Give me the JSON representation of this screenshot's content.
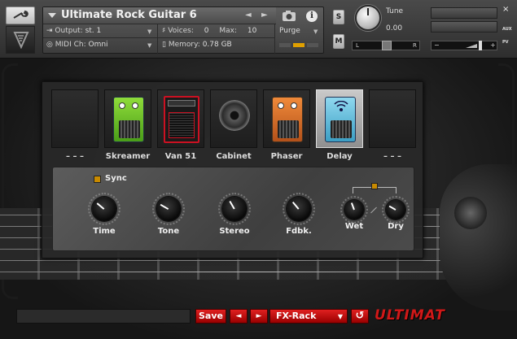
{
  "header": {
    "instrument_title": "Ultimate Rock Guitar 6",
    "output_label": "Output:",
    "output_value": "st. 1",
    "voices_label": "Voices:",
    "voices_value": "0",
    "max_label": "Max:",
    "max_value": "10",
    "purge_label": "Purge",
    "midi_label": "MIDI Ch:",
    "midi_value": "Omni",
    "memory_label": "Memory:",
    "memory_value": "0.78 GB",
    "solo_label": "S",
    "mute_label": "M",
    "tune_label": "Tune",
    "tune_value": "0.00",
    "pan_left": "L",
    "pan_right": "R",
    "vol_minus": "−",
    "vol_plus": "+",
    "aux_label": "AUX",
    "pv_label": "PV",
    "close_label": "×",
    "info_label": "i"
  },
  "fx_rack": {
    "slots": [
      {
        "label": "– – –",
        "icon": "empty-slot"
      },
      {
        "label": "Skreamer",
        "icon": "green-pedal"
      },
      {
        "label": "Van 51",
        "icon": "amp-head"
      },
      {
        "label": "Cabinet",
        "icon": "speaker-cabinet"
      },
      {
        "label": "Phaser",
        "icon": "orange-pedal"
      },
      {
        "label": "Delay",
        "icon": "blue-pedal",
        "selected": true
      },
      {
        "label": "– – –",
        "icon": "empty-slot"
      }
    ],
    "sync_label": "Sync",
    "knobs": [
      {
        "label": "Time",
        "angle": -50
      },
      {
        "label": "Tone",
        "angle": -60
      },
      {
        "label": "Stereo",
        "angle": -30
      },
      {
        "label": "Fdbk.",
        "angle": -40
      },
      {
        "label": "Wet",
        "angle": -20
      },
      {
        "label": "Dry",
        "angle": -60
      }
    ]
  },
  "footer": {
    "save_label": "Save",
    "prev_label": "◄",
    "next_label": "►",
    "preset_name": "FX-Rack",
    "reset_icon": "↺",
    "brand_text": "ULTIMAT"
  },
  "colors": {
    "accent_red": "#d01818",
    "sync_orange": "#c88a00",
    "delay_blue": "#3c9fc4"
  }
}
